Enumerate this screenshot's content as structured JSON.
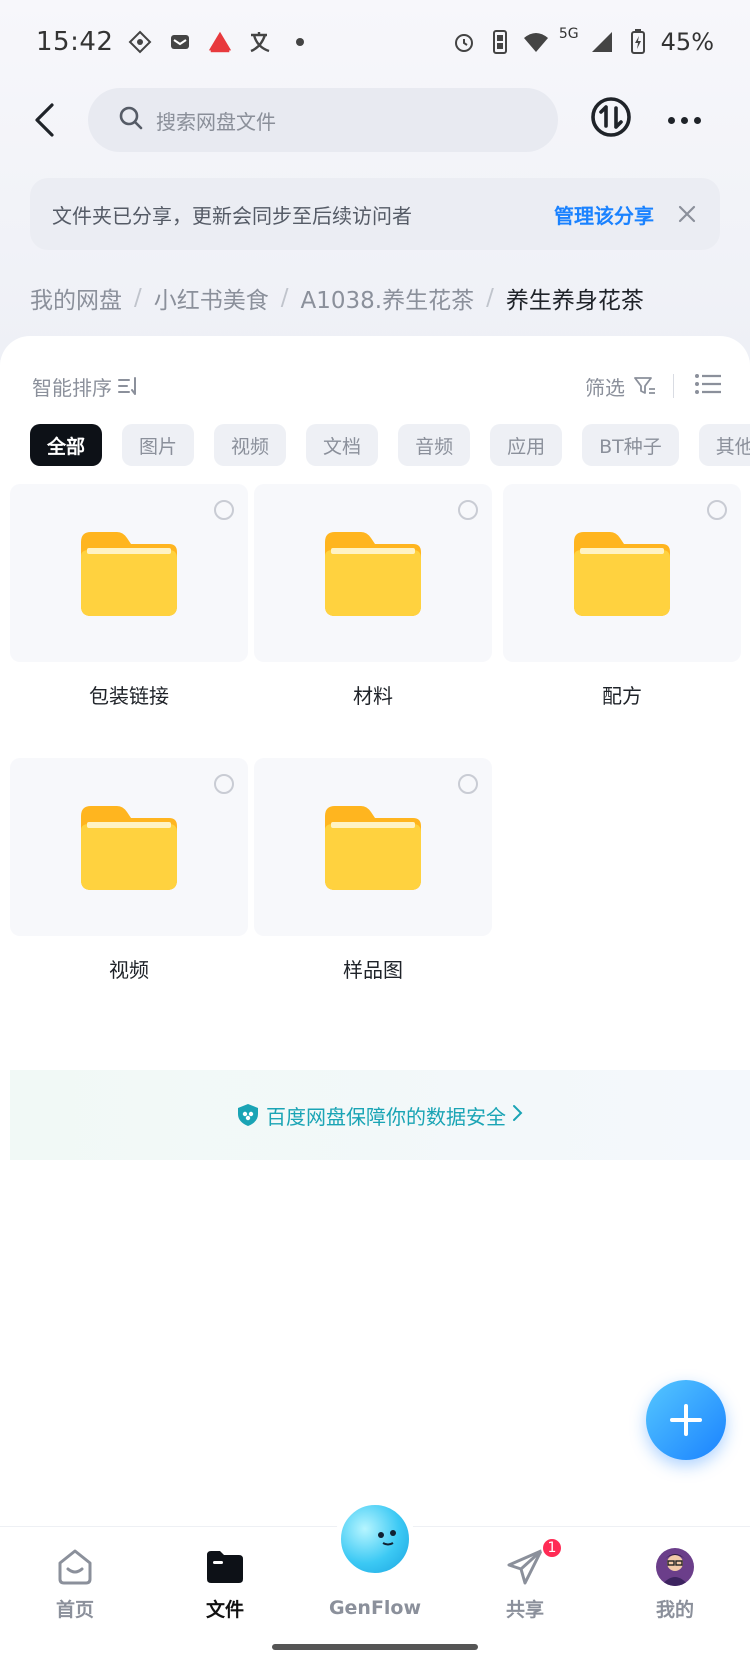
{
  "status_bar": {
    "time": "15:42",
    "network": "5G",
    "battery": "45%"
  },
  "header": {
    "search_placeholder": "搜索网盘文件"
  },
  "notice": {
    "text": "文件夹已分享，更新会同步至后续访问者",
    "link": "管理该分享"
  },
  "breadcrumb": {
    "items": [
      "我的网盘",
      "小红书美食",
      "A1038.养生花茶"
    ],
    "current": "养生养身花茶",
    "separator": "/"
  },
  "toolbar": {
    "sort_label": "智能排序",
    "filter_label": "筛选"
  },
  "chips": [
    "全部",
    "图片",
    "视频",
    "文档",
    "音频",
    "应用",
    "BT种子",
    "其他"
  ],
  "folders": [
    {
      "name": "包装链接"
    },
    {
      "name": "材料"
    },
    {
      "name": "配方"
    },
    {
      "name": "视频"
    },
    {
      "name": "样品图"
    }
  ],
  "safety_banner": {
    "text": "百度网盘保障你的数据安全"
  },
  "nav": {
    "home": "首页",
    "files": "文件",
    "genflow": "GenFlow",
    "share": "共享",
    "share_badge": "1",
    "mine": "我的"
  },
  "colors": {
    "accent": "#1a82ff",
    "folder": "#ffc933",
    "badge": "#ff2b55",
    "safety_text": "#1aa4b5"
  }
}
